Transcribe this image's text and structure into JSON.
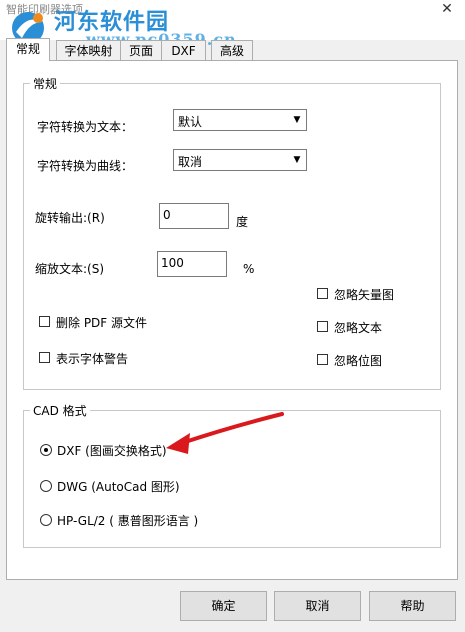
{
  "window": {
    "title": "智能印刷器选项",
    "close_glyph": "✕"
  },
  "watermark": {
    "text": "河东软件园",
    "url": "www.pc0359.cn"
  },
  "tabs": [
    {
      "label": "常规",
      "active": true
    },
    {
      "label": "字体映射",
      "active": false
    },
    {
      "label": "页面",
      "active": false
    },
    {
      "label": "DXF",
      "active": false
    },
    {
      "label": "高级",
      "active": false
    }
  ],
  "general": {
    "legend": "常规",
    "text_convert": {
      "label": "字符转换为文本：",
      "value": "默认"
    },
    "curve_convert": {
      "label": "字符转换为曲线：",
      "value": "取消"
    },
    "rotate": {
      "label": "旋转输出:(R)",
      "value": "0",
      "unit": "度"
    },
    "scale": {
      "label": "缩放文本:(S)",
      "value": "100",
      "unit": "%"
    },
    "delete_pdf": {
      "label": "删除 PDF 源文件",
      "checked": false
    },
    "font_warning": {
      "label": "表示字体警告",
      "checked": false
    },
    "ignore_vector": {
      "label": "忽略矢量图",
      "checked": false
    },
    "ignore_text": {
      "label": "忽略文本",
      "checked": false
    },
    "ignore_bitmap": {
      "label": "忽略位图",
      "checked": false
    }
  },
  "cad": {
    "legend": "CAD 格式",
    "options": [
      {
        "label": "DXF (图画交换格式)",
        "selected": true
      },
      {
        "label": "DWG (AutoCad 图形)",
        "selected": false
      },
      {
        "label": "HP-GL/2 ( 惠普图形语言 )",
        "selected": false
      }
    ]
  },
  "buttons": {
    "ok": "确定",
    "cancel": "取消",
    "help": "帮助"
  },
  "colors": {
    "annotation_arrow": "#d9191c",
    "watermark": "#2a8fd6"
  }
}
